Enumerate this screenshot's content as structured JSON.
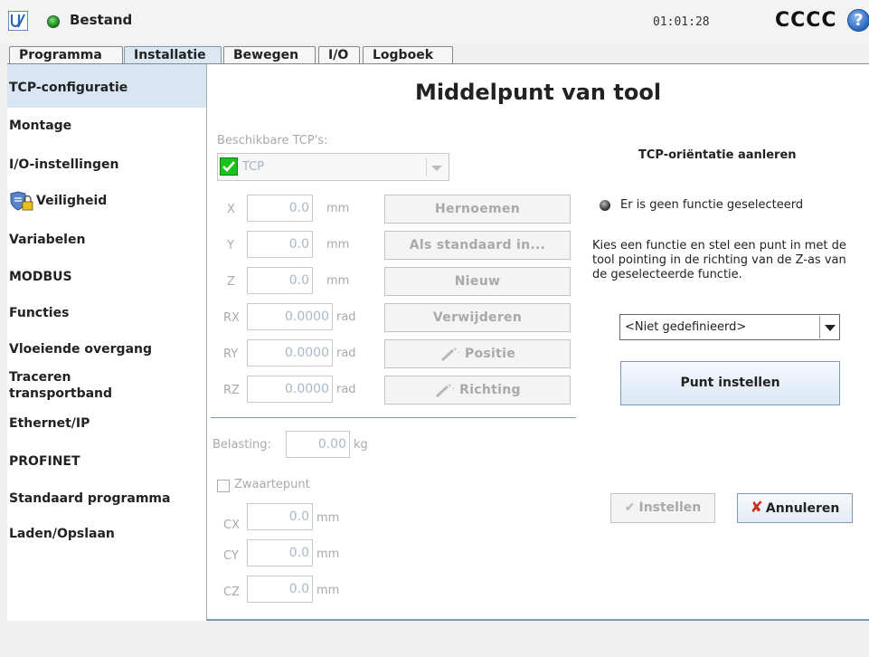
{
  "header": {
    "app_title": "Bestand",
    "clock": "01:01:28",
    "robot_name": "CCCC",
    "help_glyph": "?"
  },
  "tabs": [
    {
      "label": "Programma"
    },
    {
      "label": "Installatie",
      "active": true
    },
    {
      "label": "Bewegen"
    },
    {
      "label": "I/O"
    },
    {
      "label": "Logboek"
    }
  ],
  "sidebar": {
    "items": [
      {
        "label": "TCP-configuratie",
        "selected": true
      },
      {
        "label": "Montage"
      },
      {
        "label": "I/O-instellingen"
      },
      {
        "label": "Veiligheid",
        "icon": "shield-lock-icon"
      },
      {
        "label": "Variabelen"
      },
      {
        "label": "MODBUS"
      },
      {
        "label": "Functies"
      },
      {
        "label": "Vloeiende overgang"
      },
      {
        "label": "Traceren transportband"
      },
      {
        "label": "Ethernet/IP"
      },
      {
        "label": "PROFINET"
      },
      {
        "label": "Standaard programma"
      },
      {
        "label": "Laden/Opslaan"
      }
    ]
  },
  "main": {
    "title": "Middelpunt van tool",
    "available_tcps_label": "Beschikbare TCP's:",
    "tcp_selected": "TCP",
    "fields": [
      {
        "label": "X",
        "value": "0.0",
        "unit": "mm"
      },
      {
        "label": "Y",
        "value": "0.0",
        "unit": "mm"
      },
      {
        "label": "Z",
        "value": "0.0",
        "unit": "mm"
      },
      {
        "label": "RX",
        "value": "0.0000",
        "unit": "rad"
      },
      {
        "label": "RY",
        "value": "0.0000",
        "unit": "rad"
      },
      {
        "label": "RZ",
        "value": "0.0000",
        "unit": "rad"
      }
    ],
    "buttons": {
      "rename": "Hernoemen",
      "set_default": "Als standaard in...",
      "new": "Nieuw",
      "delete": "Verwijderen",
      "position": "Positie",
      "orientation": "Richting"
    },
    "payload_label": "Belasting:",
    "payload_value": "0.00",
    "payload_unit": "kg",
    "cog_label": "Zwaartepunt",
    "cog_checked": false,
    "cog_fields": [
      {
        "label": "CX",
        "value": "0.0",
        "unit": "mm"
      },
      {
        "label": "CY",
        "value": "0.0",
        "unit": "mm"
      },
      {
        "label": "CZ",
        "value": "0.0",
        "unit": "mm"
      }
    ]
  },
  "teach": {
    "title": "TCP-oriëntatie aanleren",
    "status": "Er is geen functie geselecteerd",
    "instruction": "Kies een functie en stel een punt in met de tool pointing in de richting van de Z-as van de geselecteerde functie.",
    "feature_selected": "<Niet gedefinieerd>",
    "set_point_label": "Punt instellen",
    "apply_label": "Instellen",
    "cancel_label": "Annuleren"
  },
  "colors": {
    "accent": "#7b9ab8",
    "selected_bg": "#d8e5f3",
    "tcp_check_green": "#1cc21c",
    "cancel_red": "#c8321e"
  }
}
